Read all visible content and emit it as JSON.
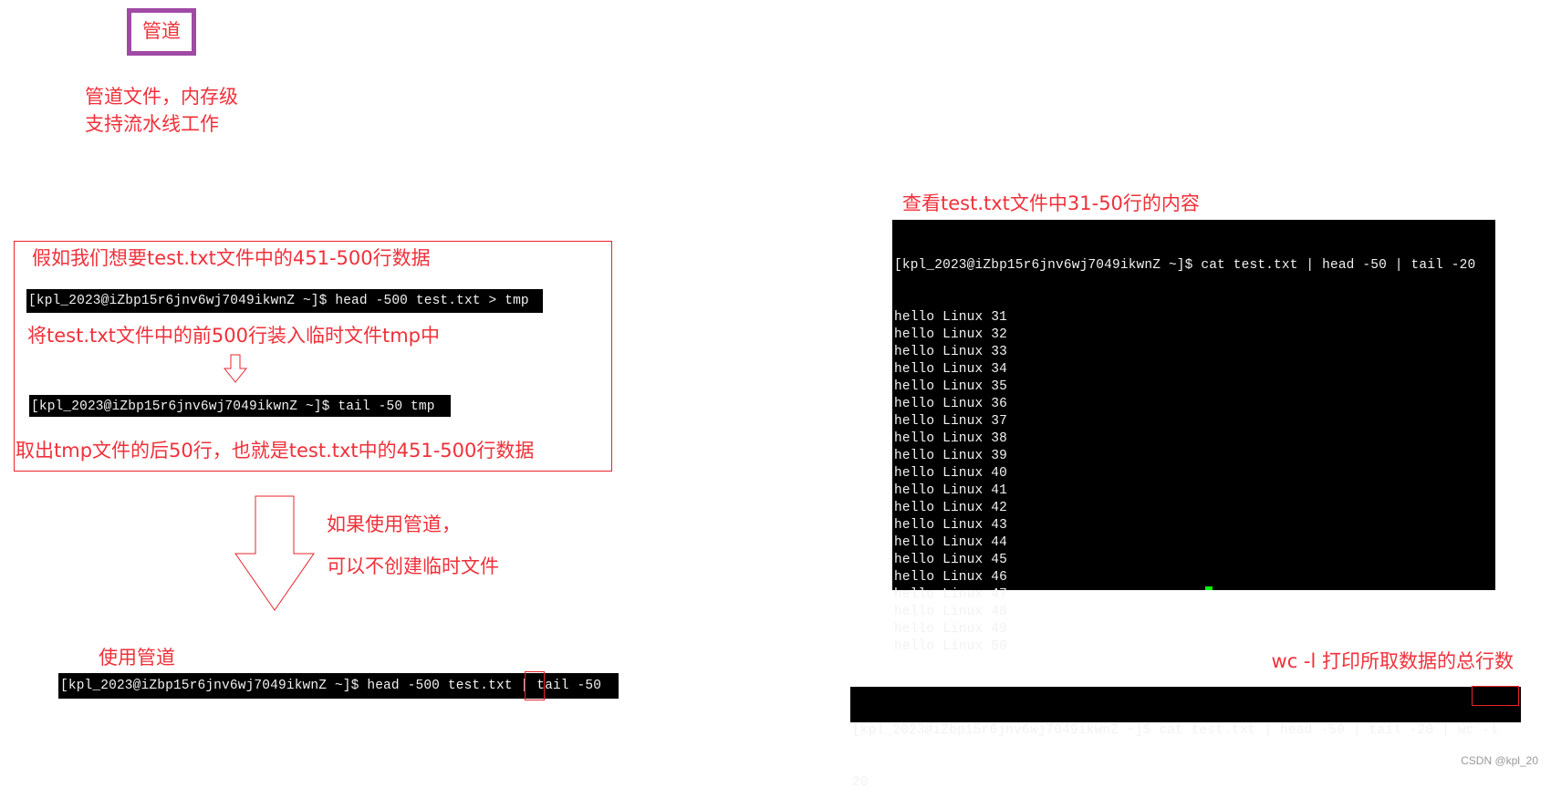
{
  "title_box": {
    "label": "管道",
    "border_color": "#a04aa5"
  },
  "intro": {
    "line1": "管道文件，内存级",
    "line2": "支持流水线工作"
  },
  "example": {
    "heading": "假如我们想要test.txt文件中的451-500行数据",
    "cmd1": "[kpl_2023@iZbp15r6jnv6wj7049ikwnZ ~]$ head -500 test.txt > tmp",
    "note1": "将test.txt文件中的前500行装入临时文件tmp中",
    "cmd2": "[kpl_2023@iZbp15r6jnv6wj7049ikwnZ ~]$ tail -50 tmp",
    "note2": "取出tmp文件的后50行，也就是test.txt中的451-500行数据"
  },
  "pipe_hint": {
    "line1": "如果使用管道，",
    "line2": "可以不创建临时文件"
  },
  "pipe_usage": {
    "label": "使用管道",
    "cmd_before": "[kpl_2023@iZbp15r6jnv6wj7049ikwnZ ~]$ head -500 test.txt ",
    "pipe": "|",
    "cmd_after": " tail -50"
  },
  "view_example": {
    "heading": "查看test.txt文件中31-50行的内容",
    "cmd": "[kpl_2023@iZbp15r6jnv6wj7049ikwnZ ~]$ cat test.txt | head -50 | tail -20",
    "output": [
      "hello Linux 31",
      "hello Linux 32",
      "hello Linux 33",
      "hello Linux 34",
      "hello Linux 35",
      "hello Linux 36",
      "hello Linux 37",
      "hello Linux 38",
      "hello Linux 39",
      "hello Linux 40",
      "hello Linux 41",
      "hello Linux 42",
      "hello Linux 43",
      "hello Linux 44",
      "hello Linux 45",
      "hello Linux 46",
      "hello Linux 47",
      "hello Linux 48",
      "hello Linux 49",
      "hello Linux 50"
    ]
  },
  "wc_example": {
    "heading": "wc -l 打印所取数据的总行数",
    "cmd_before": "[kpl_2023@iZbp15r6jnv6wj7049ikwnZ ~]$ cat test.txt | head -50 | tail -20 |",
    "cmd_highlight": "wc -l",
    "output": "20"
  },
  "watermark": "CSDN @kpl_20",
  "colors": {
    "annotation": "#f0303a",
    "terminal_bg": "#000000",
    "terminal_fg": "#f2f2f2",
    "cursor": "#00ff00"
  }
}
